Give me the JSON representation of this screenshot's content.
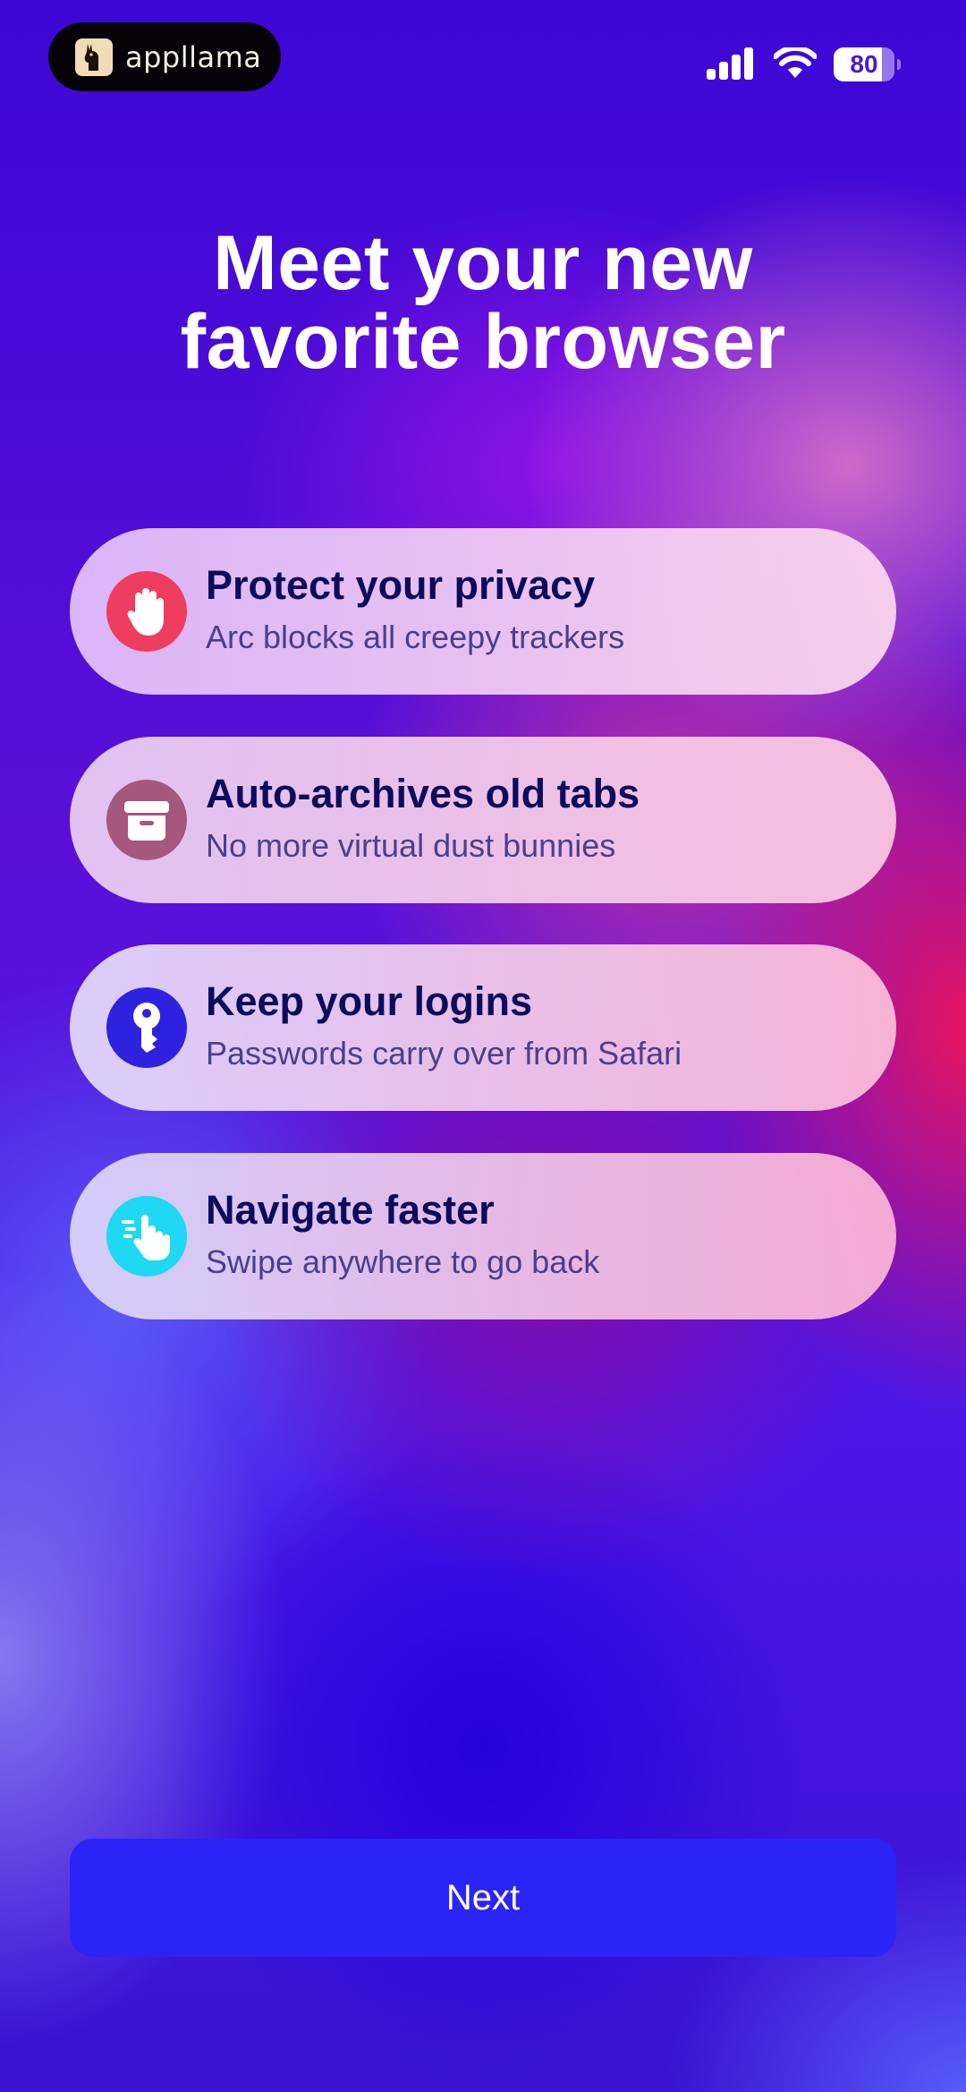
{
  "status_bar": {
    "app_name": "appllama",
    "battery_level": "80",
    "battery_fraction": 0.8,
    "icons": [
      "cellular-signal-icon",
      "wifi-icon",
      "battery-icon"
    ]
  },
  "title": {
    "line1": "Meet your new",
    "line2": "favorite browser"
  },
  "features": [
    {
      "title": "Protect your privacy",
      "subtitle": "Arc blocks all creepy trackers",
      "icon": "stop-hand-icon",
      "icon_color": "#ee3d5e"
    },
    {
      "title": "Auto-archives old tabs",
      "subtitle": "No more virtual dust bunnies",
      "icon": "archive-box-icon",
      "icon_color": "#a5577d"
    },
    {
      "title": "Keep your logins",
      "subtitle": "Passwords carry over from Safari",
      "icon": "key-icon",
      "icon_color": "#2e22e0"
    },
    {
      "title": "Navigate faster",
      "subtitle": "Swipe anywhere to go back",
      "icon": "swipe-hand-icon",
      "icon_color": "#1fd8f2"
    }
  ],
  "next_button": {
    "label": "Next"
  },
  "colors": {
    "accent": "#2a24f6",
    "title_text": "#ffffff",
    "card_title": "#0d0b5c",
    "card_subtitle": "#4a3f8e"
  }
}
